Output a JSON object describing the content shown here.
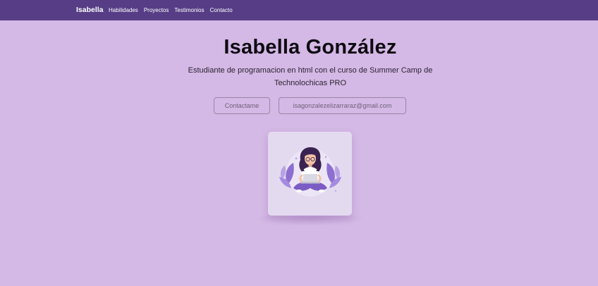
{
  "nav": {
    "brand": "Isabella",
    "links": [
      "Habilidades",
      "Proyectos",
      "Testimonios",
      "Contacto"
    ]
  },
  "hero": {
    "title": "Isabella González",
    "subtitle": "Estudiante de programacion en html con el curso de Summer Camp de Technolochicas PRO",
    "contact_button": "Contactame",
    "email_button": "isagonzalezelizarraraz@gmail.com"
  },
  "colors": {
    "navbar": "#563d86",
    "background": "#d4b8e5",
    "card": "#e4daf0",
    "accent_purple": "#7b5cc4"
  },
  "illustration": {
    "icon": "woman-with-laptop-illustration"
  }
}
